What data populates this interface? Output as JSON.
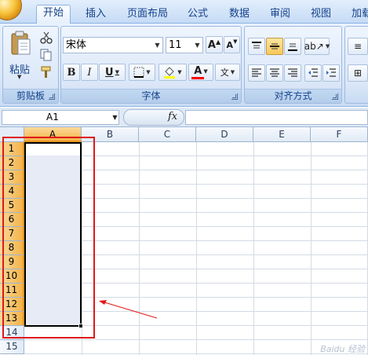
{
  "tabs": [
    "开始",
    "插入",
    "页面布局",
    "公式",
    "数据",
    "审阅",
    "视图",
    "加载"
  ],
  "active_tab": "开始",
  "clipboard": {
    "paste_label": "粘贴",
    "group_label": "剪贴板"
  },
  "font": {
    "font_name": "宋体",
    "font_size": "11",
    "bold": "B",
    "italic": "I",
    "underline": "U",
    "grow_font": "A",
    "shrink_font": "A",
    "font_color_glyph": "A",
    "phonetic_glyph": "文",
    "group_label": "字体"
  },
  "alignment": {
    "group_label": "对齐方式"
  },
  "formula_bar": {
    "name_box": "A1",
    "fx": "fx",
    "formula": ""
  },
  "columns": [
    "A",
    "B",
    "C",
    "D",
    "E",
    "F"
  ],
  "rows": [
    "1",
    "2",
    "3",
    "4",
    "5",
    "6",
    "7",
    "8",
    "9",
    "10",
    "11",
    "12",
    "13",
    "14",
    "15"
  ],
  "selection": {
    "range_start": "A1",
    "range_end": "A13",
    "selected_column": "A"
  },
  "colors": {
    "selection_header": "#f3b34a",
    "annotation": "#e01818",
    "ribbon": "#dbe8f8"
  },
  "watermark": "Baidu 经验"
}
